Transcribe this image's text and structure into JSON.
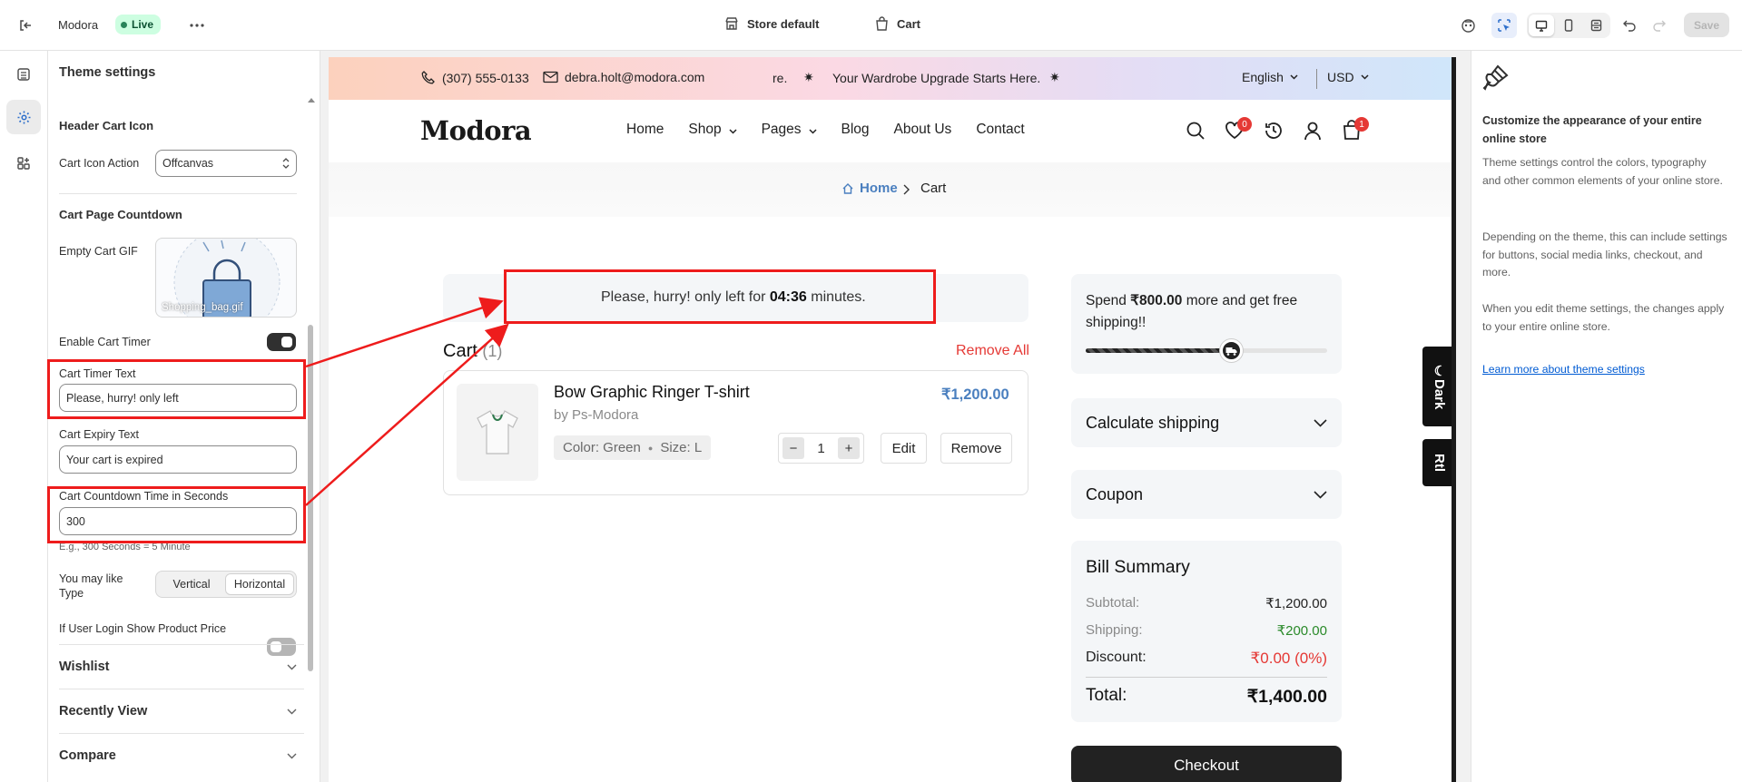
{
  "topbar": {
    "store_name": "Modora",
    "status_badge": "Live",
    "template_selector": "Store default",
    "page_selector": "Cart",
    "save_label": "Save"
  },
  "panel": {
    "title": "Theme settings",
    "header_cart_icon_heading": "Header Cart Icon",
    "cart_icon_action_label": "Cart Icon Action",
    "cart_icon_action_value": "Offcanvas",
    "cart_countdown_heading": "Cart Page Countdown",
    "empty_cart_gif_label": "Empty Cart GIF",
    "empty_cart_gif_filename": "Shopping_bag.gif",
    "enable_cart_timer_label": "Enable Cart Timer",
    "enable_cart_timer_on": true,
    "cart_timer_text_label": "Cart Timer Text",
    "cart_timer_text_value": "Please, hurry! only left",
    "cart_expiry_text_label": "Cart Expiry Text",
    "cart_expiry_text_value": "Your cart is expired",
    "countdown_seconds_label": "Cart Countdown Time in Seconds",
    "countdown_seconds_value": "300",
    "countdown_help": "E.g., 300 Seconds = 5 Minute",
    "you_may_like_label": "You may like Type",
    "you_may_like_options": [
      "Vertical",
      "Horizontal"
    ],
    "you_may_like_selected": "Horizontal",
    "login_price_label": "If User Login Show Product Price",
    "login_price_on": false,
    "accordions": [
      "Wishlist",
      "Recently View",
      "Compare"
    ]
  },
  "store": {
    "phone": "(307) 555-0133",
    "email": "debra.holt@modora.com",
    "ticker_fragment": "re.",
    "ticker_star": "✷",
    "ticker_text": "Your Wardrobe Upgrade Starts Here.",
    "language": "English",
    "currency": "USD",
    "logo": "Modora",
    "nav": [
      "Home",
      "Shop",
      "Pages",
      "Blog",
      "About Us",
      "Contact"
    ],
    "wishlist_count": "0",
    "cart_count": "1",
    "breadcrumb_home": "Home",
    "breadcrumb_current": "Cart"
  },
  "cart": {
    "timer_prefix": "Please, hurry! only left for",
    "timer_value": "04:36",
    "timer_suffix": "minutes.",
    "heading": "Cart",
    "count": "(1)",
    "remove_all": "Remove All",
    "item": {
      "name": "Bow Graphic Ringer T-shirt",
      "vendor": "by Ps-Modora",
      "price": "₹1,200.00",
      "variant_color": "Color: Green",
      "variant_sep": "●",
      "variant_size": "Size: L",
      "quantity": "1",
      "edit_label": "Edit",
      "remove_label": "Remove"
    }
  },
  "summary": {
    "shipping_msg_pre": "Spend",
    "shipping_msg_amount": "₹800.00",
    "shipping_msg_post": "more and get free shipping!!",
    "shipping_progress": 0.6,
    "calculate_shipping": "Calculate shipping",
    "coupon": "Coupon",
    "bill_title": "Bill Summary",
    "subtotal_label": "Subtotal:",
    "subtotal_value": "₹1,200.00",
    "shipping_label": "Shipping:",
    "shipping_value": "₹200.00",
    "discount_label": "Discount:",
    "discount_value": "₹0.00 (0%)",
    "total_label": "Total:",
    "total_value": "₹1,400.00",
    "checkout_label": "Checkout",
    "dark_tab": "Dark",
    "rtl_tab": "Rtl"
  },
  "info": {
    "heading": "Customize the appearance of your entire online store",
    "p1": "Theme settings control the colors, typography and other common elements of your online store.",
    "p2": "Depending on the theme, this can include settings for buttons, social media links, checkout, and more.",
    "p3": "When you edit theme settings, the changes apply to your entire online store.",
    "link": "Learn more about theme settings"
  },
  "colors": {
    "accent_blue": "#2c6ecb",
    "annotation_red": "#ee1c1c",
    "price_blue": "#4a7fbf",
    "green": "#2a8a2a",
    "red_text": "#e53935"
  }
}
